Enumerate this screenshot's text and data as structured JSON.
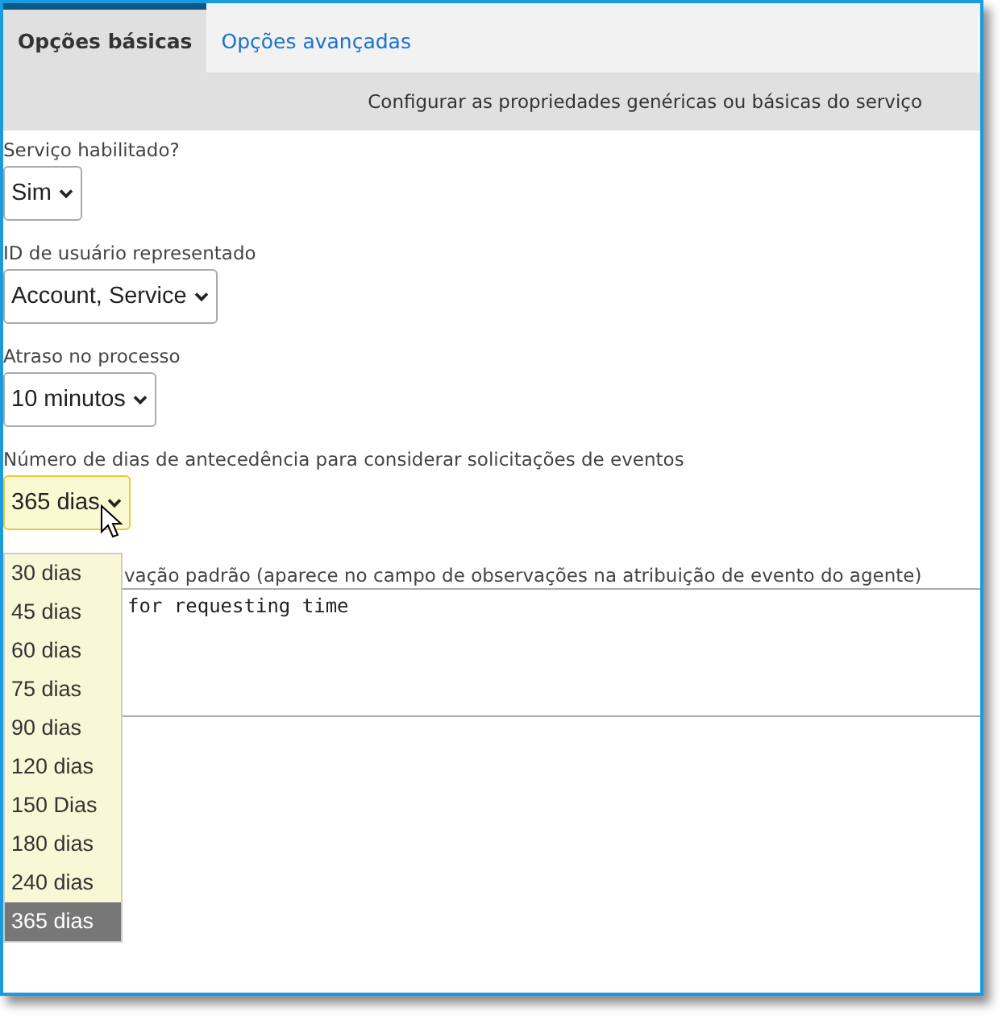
{
  "tabs": [
    {
      "label": "Opções básicas",
      "selected": true
    },
    {
      "label": "Opções avançadas",
      "selected": false
    }
  ],
  "description": "Configurar as propriedades genéricas ou básicas do serviço",
  "fields": [
    {
      "kind": "select",
      "label": "Serviço habilitado?",
      "value": "Sim",
      "focused": false
    },
    {
      "kind": "select",
      "label": "ID de usuário representado",
      "value": "Account, Service",
      "focused": false
    },
    {
      "kind": "select",
      "label": "Atraso no processo",
      "value": "10 minutos",
      "focused": false
    },
    {
      "kind": "select",
      "label": "Número de dias de antecedência para considerar solicitações de eventos",
      "value": "365 dias",
      "focused": true
    },
    {
      "kind": "textarea",
      "label": "vação padrão (aparece no campo de observações na atribuição de evento do agente)",
      "value": "for requesting time"
    }
  ],
  "dropdown": {
    "options": [
      {
        "label": "30 dias",
        "selected": false
      },
      {
        "label": "45 dias",
        "selected": false
      },
      {
        "label": "60 dias",
        "selected": false
      },
      {
        "label": "75 dias",
        "selected": false
      },
      {
        "label": "90 dias",
        "selected": false
      },
      {
        "label": "120 dias",
        "selected": false
      },
      {
        "label": "150 Dias",
        "selected": false
      },
      {
        "label": "180 dias",
        "selected": false
      },
      {
        "label": "240 dias",
        "selected": false
      },
      {
        "label": "365 dias",
        "selected": true
      }
    ]
  }
}
